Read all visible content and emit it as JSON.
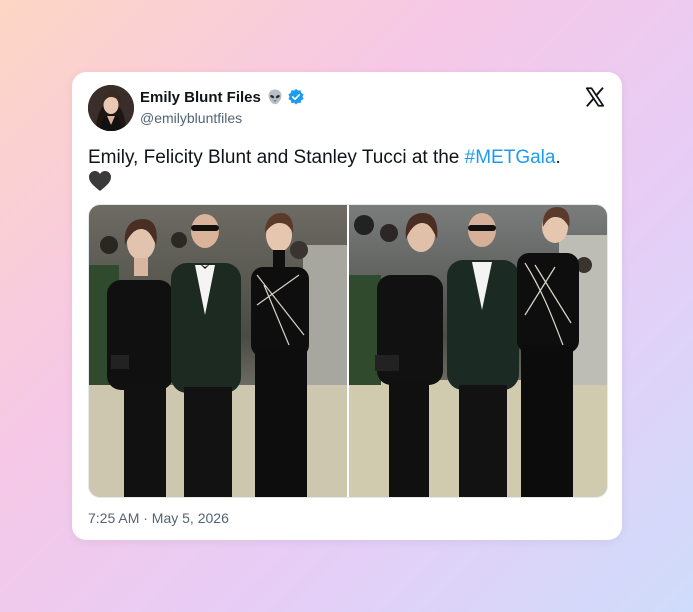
{
  "tweet": {
    "author": {
      "display_name": "Emily Blunt Files",
      "handle": "@emilybluntfiles",
      "name_emoji": "👽",
      "verified": true
    },
    "text": {
      "before_hashtag": "Emily, Felicity Blunt and Stanley Tucci at the ",
      "hashtag": "#METGala",
      "after_hashtag": ".",
      "trailing_emoji": "🖤"
    },
    "media": [
      {
        "description": "Three people in formal black attire posing on the Met Gala carpet"
      },
      {
        "description": "The same three people laughing together on the Met Gala carpet"
      }
    ],
    "timestamp": "7:25 AM · May 5, 2026"
  },
  "icons": {
    "logo": "x-logo-icon",
    "verified": "verified-badge-icon",
    "emoji": "alien-icon",
    "heart": "black-heart-icon"
  },
  "colors": {
    "link": "#1d9bf0",
    "verified": "#1d9bf0",
    "text": "#0f1419",
    "muted": "#536471"
  }
}
